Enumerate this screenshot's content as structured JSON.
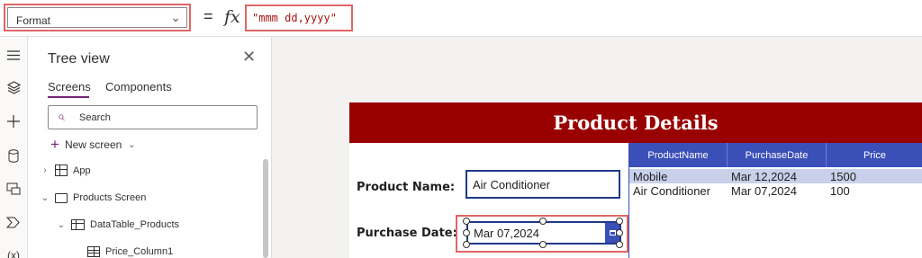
{
  "formula_bar": {
    "property": "Format",
    "equals": "=",
    "fx": "fx",
    "formula": "\"mmm dd,yyyy\""
  },
  "left_rail": {
    "icons": [
      "hamburger-menu-icon",
      "layers-icon",
      "plus-icon",
      "database-icon",
      "media-icon",
      "power-automate-icon",
      "variables-icon"
    ],
    "variables_label": "(x)"
  },
  "tree_view": {
    "title": "Tree view",
    "tabs": [
      "Screens",
      "Components"
    ],
    "active_tab": "Screens",
    "search_placeholder": "Search",
    "new_screen": "New screen",
    "items": [
      {
        "label": "App",
        "icon": "app-icon",
        "expanded": false
      },
      {
        "label": "Products Screen",
        "icon": "screen-icon",
        "expanded": true
      },
      {
        "label": "DataTable_Products",
        "icon": "table-icon",
        "expanded": true
      },
      {
        "label": "Price_Column1",
        "icon": "column-icon"
      }
    ]
  },
  "canvas": {
    "header_title": "Product Details",
    "product_name_label": "Product Name:",
    "product_name_value": "Air Conditioner",
    "purchase_date_label": "Purchase Date:",
    "purchase_date_value": "Mar 07,2024"
  },
  "data_table": {
    "columns": [
      "ProductName",
      "PurchaseDate",
      "Price"
    ],
    "rows": [
      [
        "Mobile",
        "Mar 12,2024",
        "1500"
      ],
      [
        "Air Conditioner",
        "Mar 07,2024",
        "100"
      ]
    ],
    "selected_row": 0
  },
  "colors": {
    "accent_purple": "#742774",
    "header_red": "#990000",
    "table_blue": "#3b4fb8",
    "highlight_red": "#e06666",
    "selected_row": "#c9d0ea"
  }
}
